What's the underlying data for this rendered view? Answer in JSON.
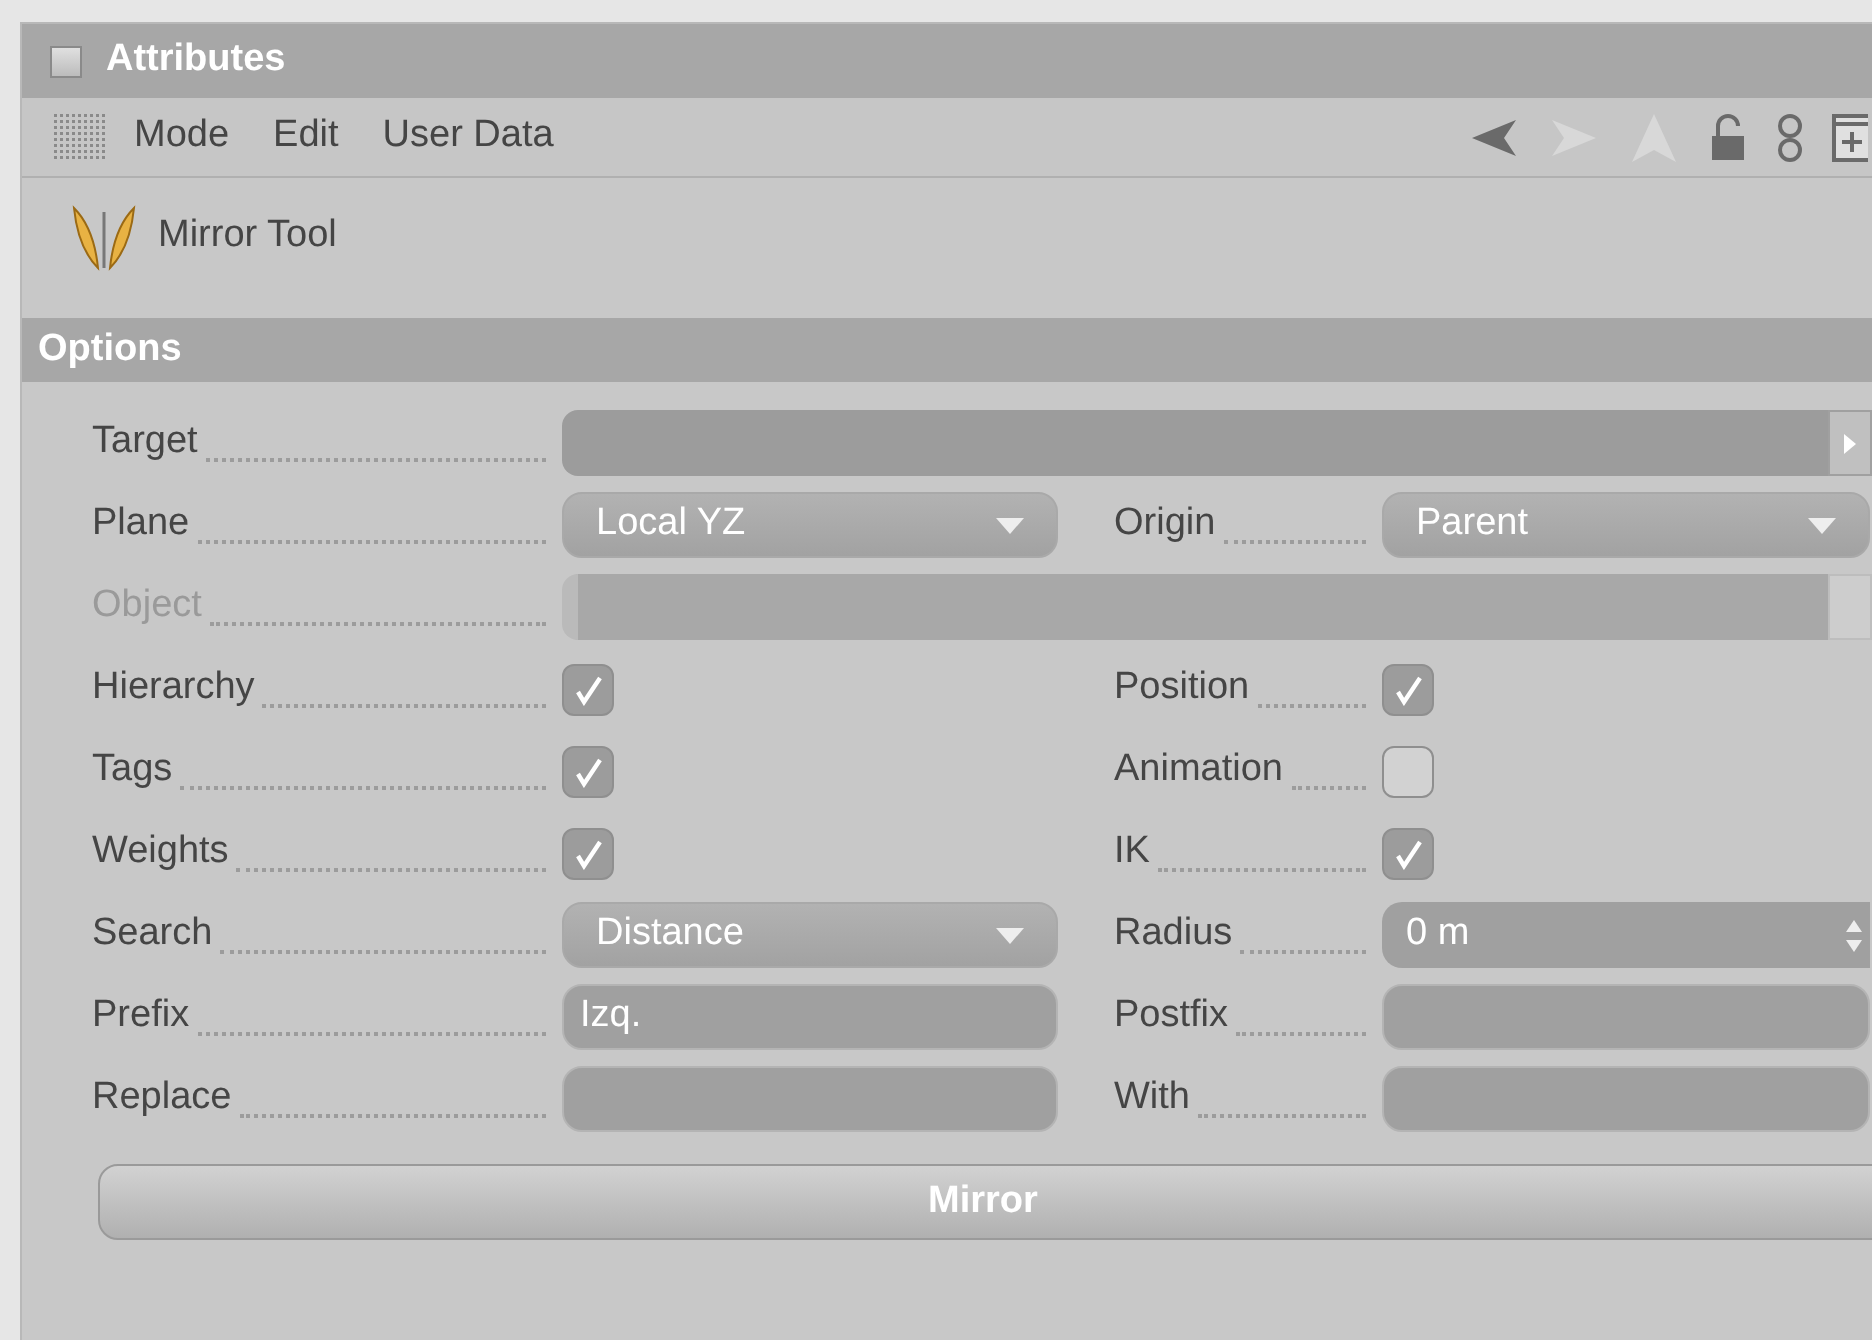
{
  "panel": {
    "title": "Attributes"
  },
  "menu": [
    "Mode",
    "Edit",
    "User Data"
  ],
  "toolbar_icons": [
    {
      "kind": "back",
      "disabled": false
    },
    {
      "kind": "forward",
      "disabled": true
    },
    {
      "kind": "up",
      "disabled": true
    },
    {
      "kind": "lock",
      "disabled": false
    },
    {
      "kind": "link",
      "disabled": false
    },
    {
      "kind": "new",
      "disabled": false
    }
  ],
  "object": {
    "name": "Mirror Tool"
  },
  "section": {
    "title": "Options"
  },
  "rows": [
    {
      "left": {
        "label": "Target",
        "kind": "link",
        "disabled": false
      }
    },
    {
      "left": {
        "label": "Plane",
        "kind": "dropdown",
        "value": "Local YZ"
      },
      "right": {
        "label": "Origin",
        "kind": "dropdown",
        "value": "Parent"
      }
    },
    {
      "left": {
        "label": "Object",
        "kind": "link",
        "disabled": true
      }
    },
    {
      "left": {
        "label": "Hierarchy",
        "kind": "checkbox",
        "checked": true
      },
      "right": {
        "label": "Position",
        "kind": "checkbox",
        "checked": true
      }
    },
    {
      "left": {
        "label": "Tags",
        "kind": "checkbox",
        "checked": true
      },
      "right": {
        "label": "Animation",
        "kind": "checkbox",
        "checked": false
      }
    },
    {
      "left": {
        "label": "Weights",
        "kind": "checkbox",
        "checked": true
      },
      "right": {
        "label": "IK",
        "kind": "checkbox",
        "checked": true
      }
    },
    {
      "left": {
        "label": "Search",
        "kind": "dropdown",
        "value": "Distance"
      },
      "right": {
        "label": "Radius",
        "kind": "spinner",
        "value": "0 m"
      }
    },
    {
      "left": {
        "label": "Prefix",
        "kind": "text",
        "value": "Izq."
      },
      "right": {
        "label": "Postfix",
        "kind": "text"
      }
    },
    {
      "left": {
        "label": "Replace",
        "kind": "text"
      },
      "right": {
        "label": "With",
        "kind": "text"
      }
    }
  ],
  "action_button": "Mirror"
}
